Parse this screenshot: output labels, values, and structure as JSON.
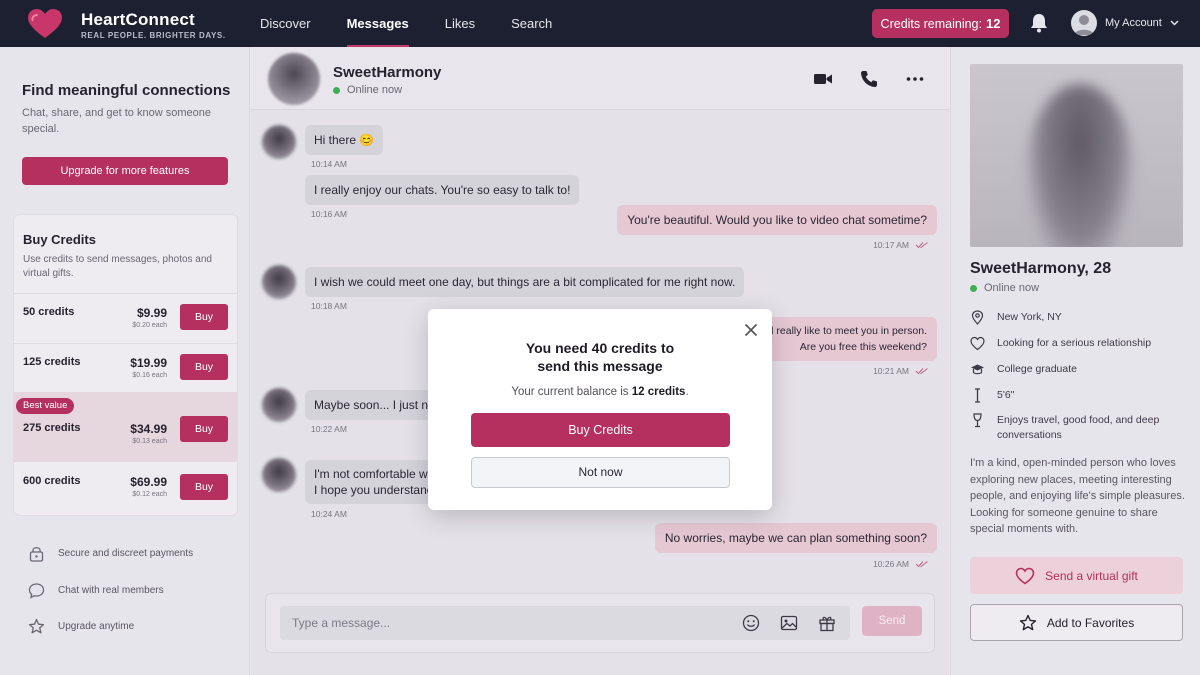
{
  "brand": {
    "name": "HeartConnect",
    "tagline": "REAL PEOPLE. BRIGHTER DAYS.",
    "accent": "#b5305f"
  },
  "nav": {
    "items": [
      "Discover",
      "Messages",
      "Likes",
      "Search"
    ],
    "active": "Messages"
  },
  "header": {
    "credits_label": "Credits remaining:",
    "credits_value": "12",
    "account_label": "My Account"
  },
  "sidebar": {
    "promo_title": "Find meaningful connections",
    "promo_text": "Chat, share, and get to know someone special.",
    "upgrade_label": "Upgrade for more features",
    "buy_title": "Buy Credits",
    "buy_text": "Use credits to send messages, photos and virtual gifts.",
    "packages": [
      {
        "name": "50 credits",
        "price": "$9.99",
        "each": "$0.20 each",
        "buy": "Buy"
      },
      {
        "name": "125 credits",
        "price": "$19.99",
        "each": "$0.16 each",
        "buy": "Buy"
      },
      {
        "name": "275 credits",
        "price": "$34.99",
        "each": "$0.13 each",
        "buy": "Buy",
        "badge": "Best value"
      },
      {
        "name": "600 credits",
        "price": "$69.99",
        "each": "$0.12 each",
        "buy": "Buy"
      }
    ],
    "features": [
      "Secure and discreet payments",
      "Chat with real members",
      "Upgrade anytime"
    ]
  },
  "chat": {
    "contact_name": "SweetHarmony",
    "contact_status": "Online now",
    "messages": [
      {
        "from": "them",
        "text": "Hi there 😊",
        "time": "10:14 AM"
      },
      {
        "from": "them",
        "text": "I really enjoy our chats. You're so easy to talk to!",
        "time": "10:16 AM"
      },
      {
        "from": "me",
        "text": "You're beautiful. Would you like to video chat sometime?",
        "time": "10:17 AM"
      },
      {
        "from": "them",
        "text": "I wish we could meet one day, but things are a bit complicated for me right now.",
        "time": "10:18 AM"
      },
      {
        "from": "me",
        "text_line1": "I'd really like to meet you in person.",
        "text_line2": "Are you free this weekend?",
        "time": "10:21 AM"
      },
      {
        "from": "them",
        "text": "Maybe soon... I just need",
        "time": "10:22 AM"
      },
      {
        "from": "them",
        "text_line1": "I'm not comfortable with",
        "text_line2": "I hope you understand",
        "time": "10:24 AM"
      },
      {
        "from": "me",
        "text": "No worries, maybe we can plan something soon?",
        "time": "10:26 AM"
      }
    ],
    "input_placeholder": "Type a message...",
    "send_label": "Send"
  },
  "profile": {
    "name_age": "SweetHarmony, 28",
    "status": "Online now",
    "location": "New York, NY",
    "looking_for": "Looking for a serious relationship",
    "education": "College graduate",
    "height": "5'6\"",
    "interests": "Enjoys travel, good food, and deep conversations",
    "bio": "I'm a kind, open-minded person who loves exploring new places, meeting interesting people, and enjoying life's simple pleasures. Looking for someone genuine to share special moments with.",
    "gift_label": "Send a virtual gift",
    "favorite_label": "Add to Favorites"
  },
  "modal": {
    "title_line1": "You need 40 credits to",
    "title_line2": "send this message",
    "balance_prefix": "Your current balance is",
    "balance_value": "12 credits",
    "balance_suffix": ".",
    "buy_label": "Buy Credits",
    "dismiss_label": "Not now"
  }
}
